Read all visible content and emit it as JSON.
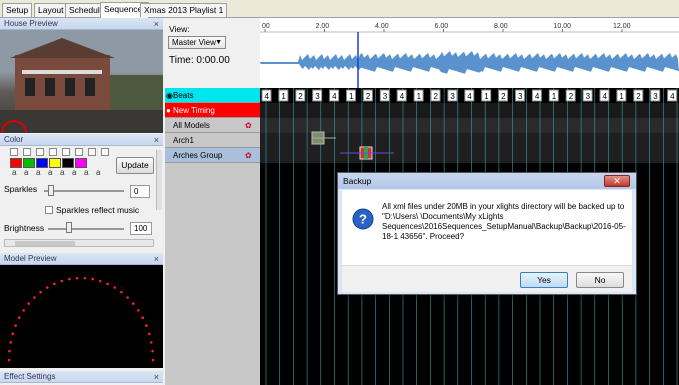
{
  "tabs": [
    "Setup",
    "Layout",
    "Schedule",
    "Sequencer",
    "Xmas 2013 Playlist 1"
  ],
  "panels": {
    "house_preview": "House Preview",
    "color": "Color",
    "model_preview": "Model Preview",
    "effect_settings": "Effect Settings",
    "close": "×"
  },
  "color_panel": {
    "swatch_colors": [
      "#ff0000",
      "#00c000",
      "#0000ff",
      "#ffff00",
      "#000000",
      "#ff00ff"
    ],
    "update_label": "Update",
    "sparkles_label": "Sparkles",
    "sparkles_value": "0",
    "sparkles_reflect_label": "Sparkles reflect music",
    "brightness_label": "Brightness",
    "brightness_value": "100"
  },
  "view": {
    "label": "View:",
    "selected": "Master View",
    "time": "Time: 0:00.00"
  },
  "ruler": [
    "00",
    "2.00",
    "4.00",
    "6.00",
    "8.00",
    "10.00",
    "12.00"
  ],
  "rows": [
    {
      "label": "Beats",
      "color": "#00e5ee"
    },
    {
      "label": "New Timing",
      "color": "#ff0000"
    },
    {
      "label": "All Models",
      "color": "#c8c8c8"
    },
    {
      "label": "Arch1",
      "color": "#c8c8c8"
    },
    {
      "label": "Arches Group",
      "color": "#a8c0dc"
    }
  ],
  "beat_labels": [
    "4",
    "1",
    "2",
    "3",
    "4",
    "1",
    "2",
    "3",
    "4",
    "1",
    "2",
    "3",
    "4",
    "1",
    "2",
    "3",
    "4",
    "1",
    "2",
    "3",
    "4",
    "1",
    "2",
    "3",
    "4"
  ],
  "dialog": {
    "title": "Backup",
    "message": "All xml files under 20MB in your xlights directory will be backed up to \"D:\\Users\\            \\Documents\\My xLights Sequences\\2016Sequences_SetupManual\\Backup\\Backup\\2016-05-18-1 43656\". Proceed?",
    "yes_label": "Yes",
    "no_label": "No"
  }
}
